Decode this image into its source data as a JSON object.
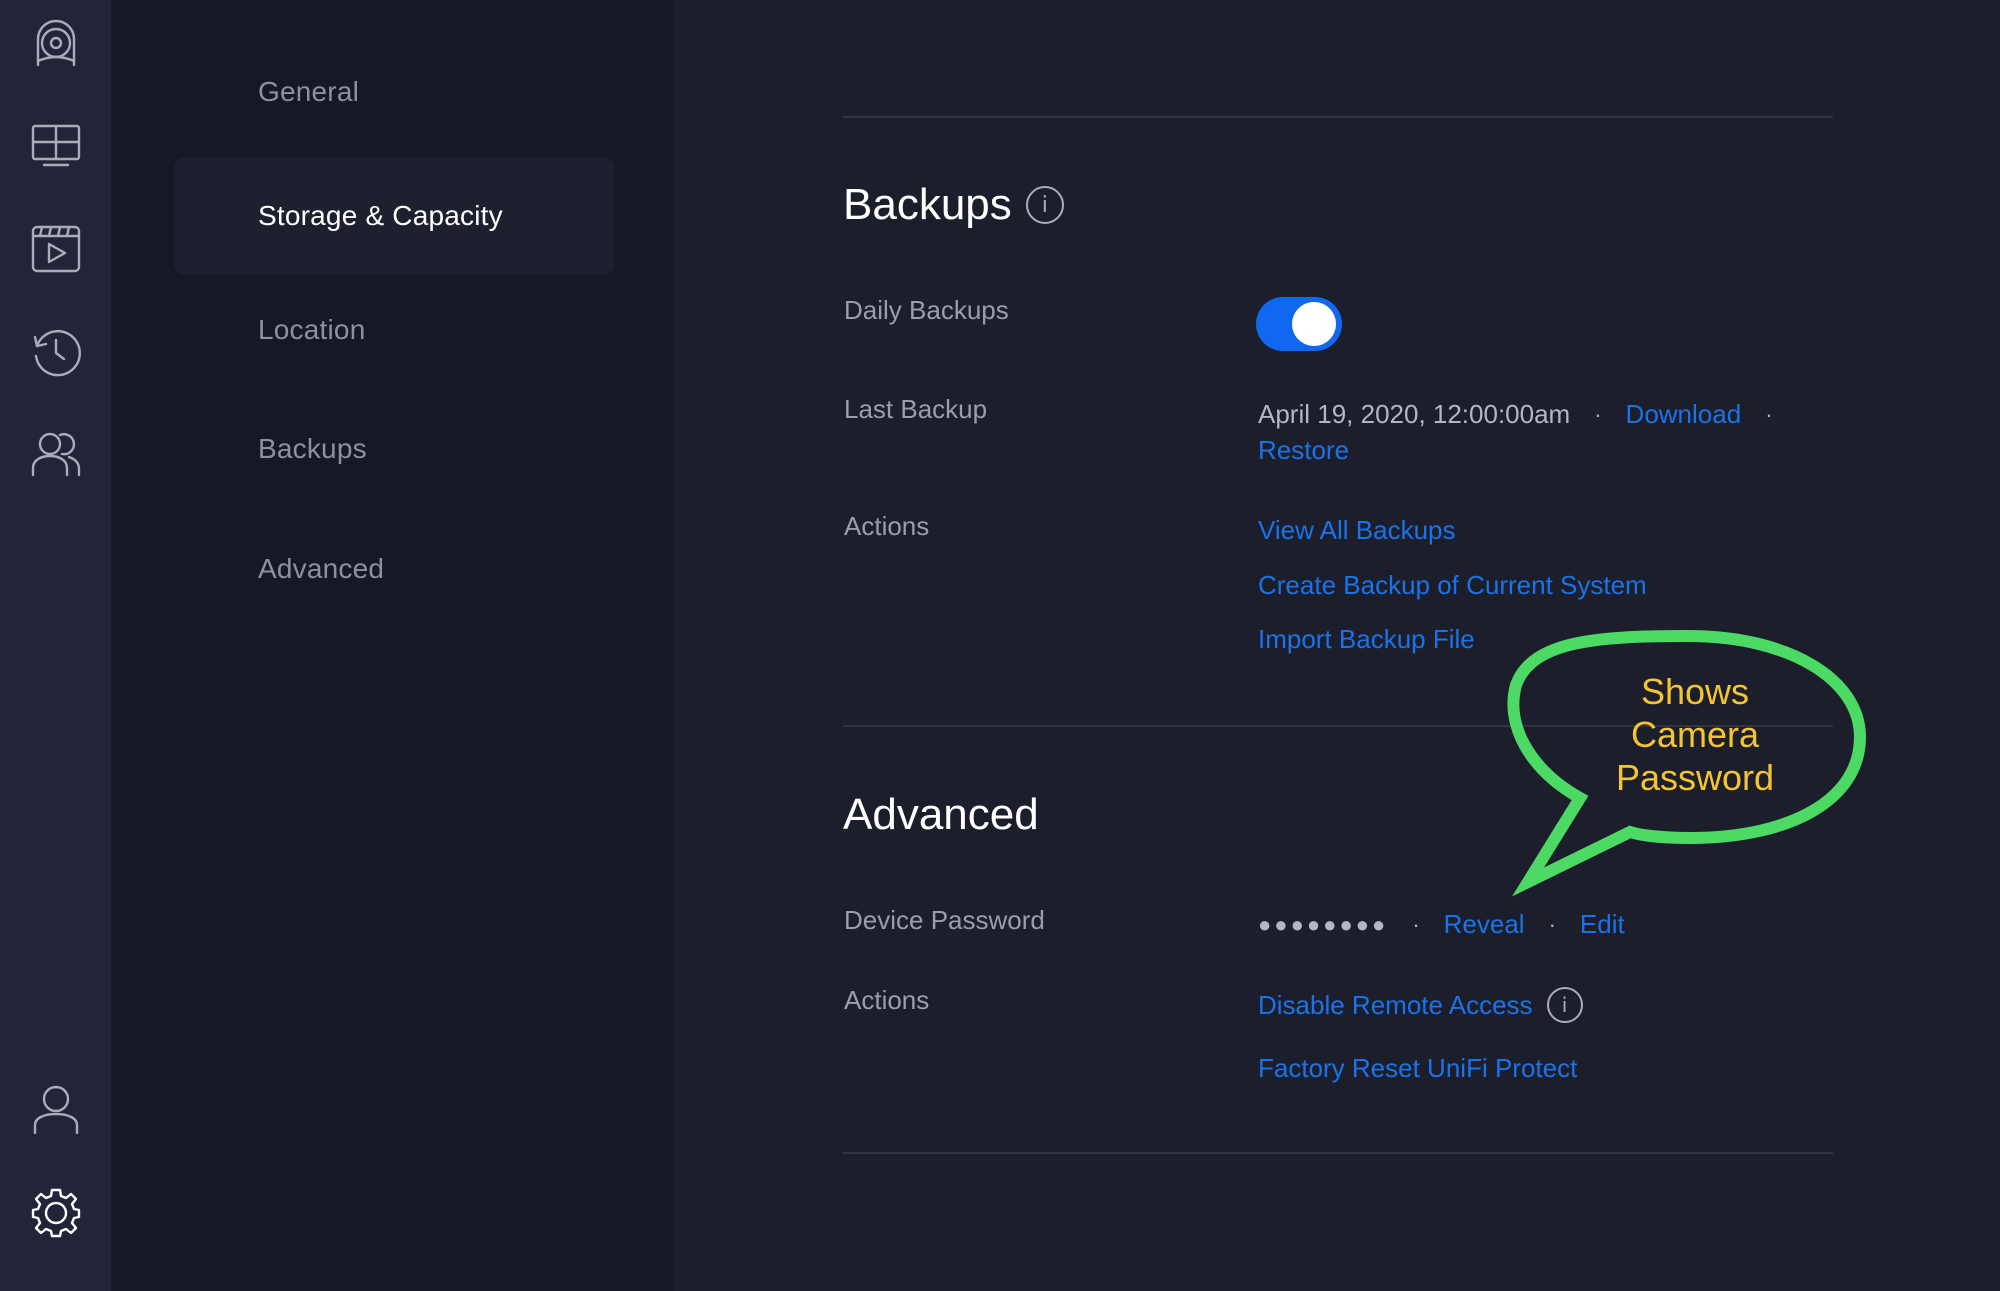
{
  "sidebar": {
    "icons": [
      {
        "name": "camera-icon",
        "label": "Cameras"
      },
      {
        "name": "liveview-grid-icon",
        "label": "Live View"
      },
      {
        "name": "video-player-icon",
        "label": "Timelapse"
      },
      {
        "name": "history-icon",
        "label": "Events"
      },
      {
        "name": "users-icon",
        "label": "Users"
      },
      {
        "name": "user-icon",
        "label": "Account"
      },
      {
        "name": "gear-icon",
        "label": "Settings"
      }
    ]
  },
  "nav": {
    "items": [
      {
        "label": "General",
        "active": false
      },
      {
        "label": "Storage & Capacity",
        "active": true
      },
      {
        "label": "Location",
        "active": false
      },
      {
        "label": "Backups",
        "active": false
      },
      {
        "label": "Advanced",
        "active": false
      }
    ]
  },
  "backups": {
    "title": "Backups",
    "info_glyph": "i",
    "daily_label": "Daily Backups",
    "daily_enabled": true,
    "last_label": "Last Backup",
    "last_value": "April 19, 2020, 12:00:00am",
    "separator": "·",
    "download_label": "Download",
    "restore_label": "Restore",
    "actions_label": "Actions",
    "actions": [
      "View All Backups",
      "Create Backup of Current System",
      "Import Backup File"
    ]
  },
  "advanced": {
    "title": "Advanced",
    "password_label": "Device Password",
    "password_mask": "●●●●●●●●",
    "separator": "·",
    "reveal_label": "Reveal",
    "edit_label": "Edit",
    "actions_label": "Actions",
    "disable_remote_label": "Disable Remote Access",
    "info_glyph": "i",
    "factory_reset_label": "Factory Reset UniFi Protect"
  },
  "annotation": {
    "lines": [
      "Shows",
      "Camera",
      "Password"
    ],
    "stroke_color": "#4cd964",
    "text_color": "#f5c531"
  },
  "colors": {
    "accent": "#1a73e8",
    "toggle_on": "#1068f0"
  }
}
